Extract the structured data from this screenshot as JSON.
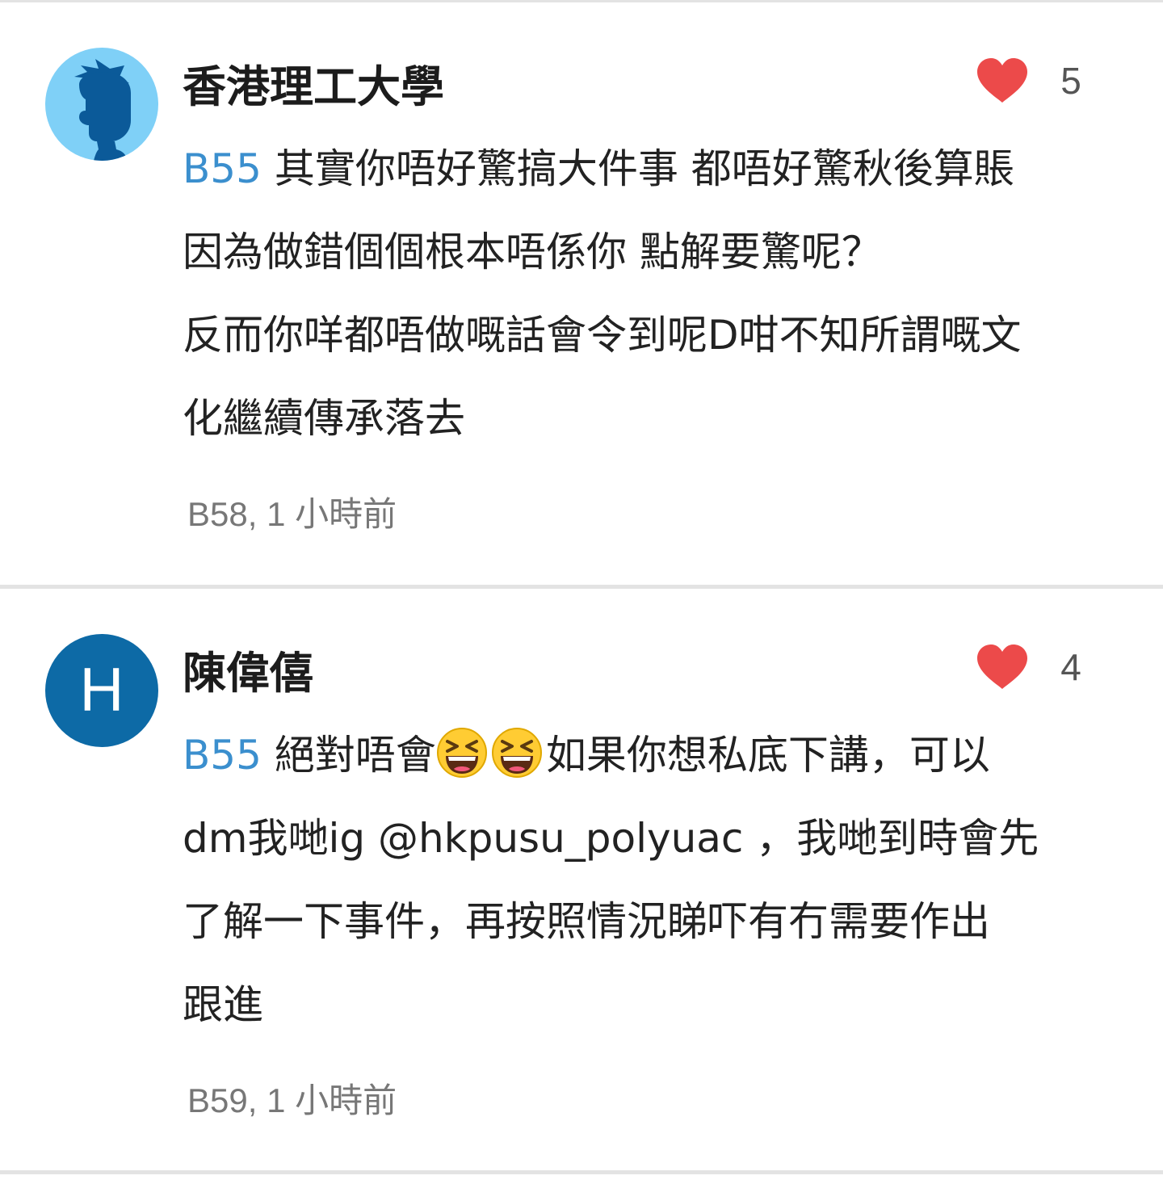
{
  "comments": [
    {
      "author": "香港理工大學",
      "avatar": {
        "type": "default-silhouette",
        "color": "#7fd0f7",
        "silhouette_color": "#0b5a99"
      },
      "likes": "5",
      "reply_to": "B55",
      "lines": [
        " 其實你唔好驚搞大件事 都唔好驚秋後算賬",
        "因為做錯個個根本唔係你 點解要驚呢？",
        "反而你咩都唔做嘅話會令到呢D咁不知所謂嘅文",
        "化繼續傳承落去"
      ],
      "meta": "B58, 1 小時前"
    },
    {
      "author": "陳偉僖",
      "avatar": {
        "type": "letter",
        "letter": "H",
        "color": "#0d6aa6"
      },
      "likes": "4",
      "reply_to": "B55",
      "line1_before_emoji": " 絕對唔會",
      "emojis": [
        "grinning-squinting-face",
        "grinning-squinting-face"
      ],
      "line1_after_emoji": "如果你想私底下講，可以",
      "lines_rest": [
        "dm我哋ig @hkpusu_polyuac ，我哋到時會先",
        "了解一下事件，再按照情況睇吓有冇需要作出",
        "跟進"
      ],
      "meta": "B59, 1 小時前"
    }
  ],
  "colors": {
    "heart": "#ec4a4a",
    "reply_ref": "#3b8fce",
    "meta_text": "#777777",
    "divider": "#e3e3e3"
  },
  "icons": {
    "like": "heart-icon",
    "emoji": "grinning-squinting-face-emoji"
  }
}
